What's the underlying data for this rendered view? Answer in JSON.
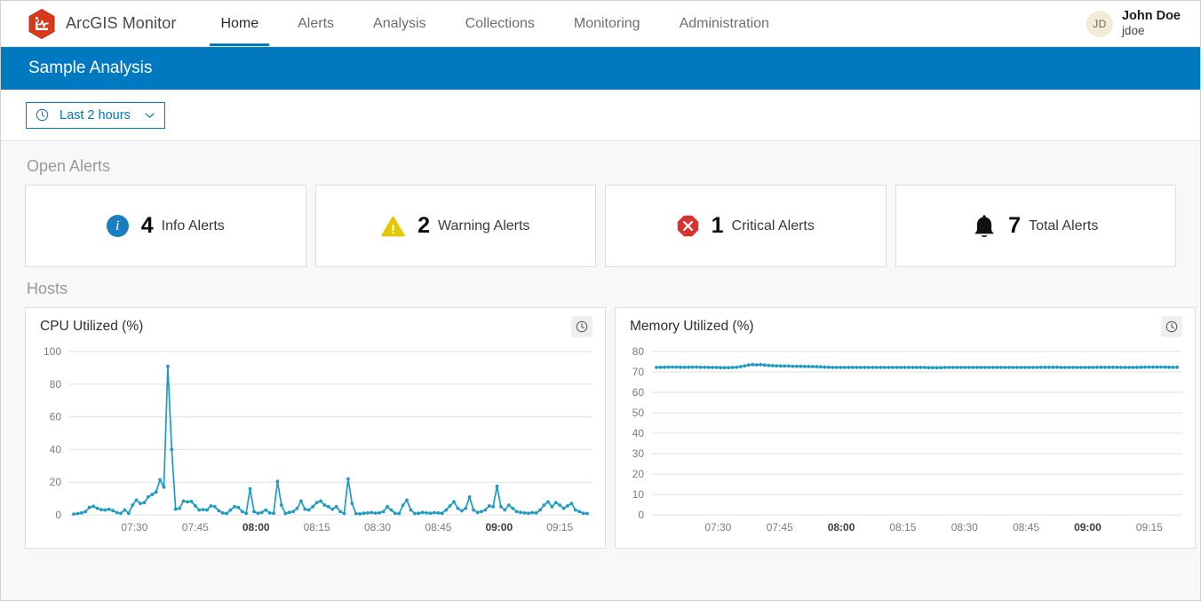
{
  "app": {
    "brand_name": "ArcGIS Monitor",
    "logo_icon": "arcgis-monitor-hexagon-pulse-icon",
    "accent_blue": "#0079c1",
    "brand_red": "#d8391b",
    "series_color": "#1d9bc7"
  },
  "nav": {
    "items": [
      {
        "label": "Home",
        "active": true
      },
      {
        "label": "Alerts",
        "active": false
      },
      {
        "label": "Analysis",
        "active": false
      },
      {
        "label": "Collections",
        "active": false
      },
      {
        "label": "Monitoring",
        "active": false
      },
      {
        "label": "Administration",
        "active": false
      }
    ]
  },
  "user": {
    "initials": "JD",
    "name": "John Doe",
    "handle": "jdoe"
  },
  "titlebar": {
    "title": "Sample Analysis"
  },
  "filter": {
    "clock_icon": "clock-icon",
    "value": "Last 2 hours",
    "chevron_icon": "chevron-down-icon"
  },
  "open_alerts": {
    "heading": "Open Alerts",
    "cards": [
      {
        "icon": "info-circle-icon",
        "count": "4",
        "label": "Info Alerts",
        "color": "#1a7fc1"
      },
      {
        "icon": "warning-triangle-icon",
        "count": "2",
        "label": "Warning Alerts",
        "color": "#e3c700"
      },
      {
        "icon": "critical-octagon-icon",
        "count": "1",
        "label": "Critical Alerts",
        "color": "#d93232"
      },
      {
        "icon": "bell-icon",
        "count": "7",
        "label": "Total Alerts",
        "color": "#111111"
      }
    ]
  },
  "hosts": {
    "heading": "Hosts",
    "charts": [
      {
        "title": "CPU Utilized (%)",
        "clock_icon": "clock-icon"
      },
      {
        "title": "Memory Utilized (%)",
        "clock_icon": "clock-icon"
      }
    ]
  },
  "chart_data": [
    {
      "type": "line",
      "title": "CPU Utilized (%)",
      "xlabel": "",
      "ylabel": "",
      "ylim": [
        0,
        100
      ],
      "yticks": [
        0,
        20,
        40,
        60,
        80,
        100
      ],
      "grid": true,
      "legend": "none",
      "xticks": [
        "07:30",
        "07:45",
        "08:00",
        "08:15",
        "08:30",
        "08:45",
        "09:00",
        "09:15"
      ],
      "xticks_bold": [
        "08:00",
        "09:00"
      ],
      "x_start": "07:20",
      "x_end": "09:18",
      "series": [
        {
          "name": "CPU Utilized (%)",
          "values": [
            0.5,
            0.8,
            1.2,
            2.0,
            4.5,
            5.2,
            4.0,
            3.2,
            3.0,
            3.4,
            2.6,
            1.4,
            0.9,
            3.0,
            1.0,
            6.0,
            9.0,
            7.0,
            7.5,
            11.0,
            12.5,
            14.0,
            21.5,
            17.0,
            91.0,
            40.0,
            3.5,
            4.0,
            8.5,
            8.0,
            8.2,
            5.5,
            3.0,
            3.2,
            3.0,
            5.5,
            5.0,
            2.5,
            1.2,
            0.8,
            3.0,
            5.0,
            4.5,
            2.0,
            1.0,
            16.0,
            2.0,
            1.0,
            1.5,
            3.0,
            1.2,
            0.9,
            20.5,
            6.0,
            0.8,
            1.5,
            2.0,
            4.0,
            8.5,
            3.5,
            3.0,
            5.0,
            7.5,
            8.5,
            6.0,
            5.0,
            3.5,
            5.0,
            2.0,
            0.8,
            22.0,
            7.0,
            0.8,
            0.6,
            1.0,
            1.2,
            1.4,
            1.1,
            1.3,
            2.0,
            5.0,
            3.0,
            1.0,
            0.8,
            6.0,
            9.0,
            3.0,
            0.8,
            1.0,
            1.5,
            1.2,
            1.0,
            1.4,
            1.2,
            1.0,
            3.0,
            5.5,
            8.0,
            4.0,
            2.5,
            4.0,
            11.0,
            3.0,
            1.5,
            2.0,
            3.0,
            5.5,
            5.0,
            17.5,
            5.0,
            3.0,
            6.0,
            4.0,
            2.0,
            1.5,
            1.2,
            1.0,
            1.4,
            1.2,
            3.0,
            6.0,
            8.0,
            5.0,
            7.5,
            6.0,
            4.0,
            5.5,
            7.0,
            3.0,
            2.0,
            1.0,
            0.8
          ]
        }
      ]
    },
    {
      "type": "line",
      "title": "Memory Utilized (%)",
      "xlabel": "",
      "ylabel": "",
      "ylim": [
        0,
        80
      ],
      "yticks": [
        0,
        10,
        20,
        30,
        40,
        50,
        60,
        70,
        80
      ],
      "grid": true,
      "legend": "none",
      "xticks": [
        "07:30",
        "07:45",
        "08:00",
        "08:15",
        "08:30",
        "08:45",
        "09:00",
        "09:15"
      ],
      "xticks_bold": [
        "08:00",
        "09:00"
      ],
      "x_start": "07:20",
      "x_end": "09:18",
      "series": [
        {
          "name": "Memory Utilized (%)",
          "values": [
            72.2,
            72.3,
            72.3,
            72.4,
            72.4,
            72.4,
            72.3,
            72.3,
            72.3,
            72.4,
            72.4,
            72.3,
            72.3,
            72.2,
            72.2,
            72.2,
            72.1,
            72.1,
            72.1,
            72.2,
            72.3,
            72.6,
            73.0,
            73.4,
            73.6,
            73.5,
            73.6,
            73.4,
            73.2,
            73.1,
            73.0,
            72.9,
            72.9,
            72.9,
            72.8,
            72.8,
            72.8,
            72.7,
            72.7,
            72.6,
            72.6,
            72.5,
            72.4,
            72.3,
            72.2,
            72.2,
            72.2,
            72.2,
            72.2,
            72.2,
            72.2,
            72.2,
            72.2,
            72.2,
            72.2,
            72.2,
            72.2,
            72.2,
            72.2,
            72.2,
            72.2,
            72.2,
            72.2,
            72.2,
            72.2,
            72.2,
            72.2,
            72.2,
            72.1,
            72.1,
            72.1,
            72.1,
            72.2,
            72.2,
            72.2,
            72.2,
            72.2,
            72.2,
            72.2,
            72.2,
            72.2,
            72.2,
            72.2,
            72.2,
            72.2,
            72.2,
            72.2,
            72.2,
            72.2,
            72.2,
            72.2,
            72.2,
            72.2,
            72.2,
            72.2,
            72.2,
            72.3,
            72.3,
            72.3,
            72.3,
            72.3,
            72.2,
            72.2,
            72.2,
            72.2,
            72.2,
            72.2,
            72.2,
            72.2,
            72.2,
            72.3,
            72.3,
            72.3,
            72.3,
            72.3,
            72.3,
            72.2,
            72.2,
            72.2,
            72.2,
            72.2,
            72.3,
            72.4,
            72.4,
            72.4,
            72.4,
            72.4,
            72.4,
            72.3,
            72.3,
            72.3
          ]
        }
      ]
    }
  ]
}
